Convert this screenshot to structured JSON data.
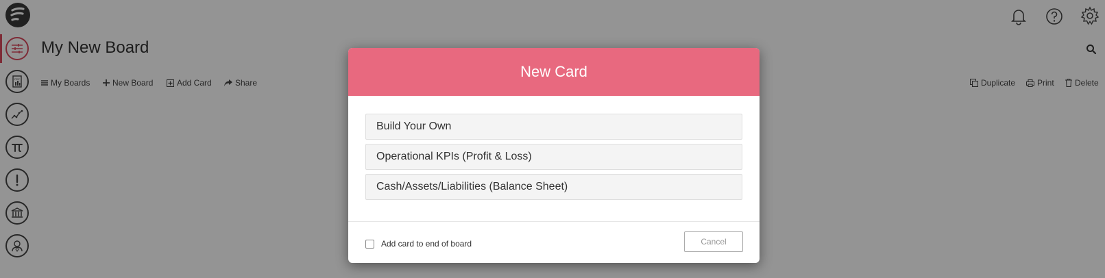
{
  "header": {
    "logo_icon": "brand-logo-icon",
    "icons": [
      "bell-icon",
      "help-icon",
      "gear-icon"
    ]
  },
  "sidebar": {
    "items": [
      {
        "icon": "sliders-icon",
        "active": true
      },
      {
        "icon": "pdf-report-icon"
      },
      {
        "icon": "trend-chart-icon"
      },
      {
        "icon": "pi-icon"
      },
      {
        "icon": "alert-icon"
      },
      {
        "icon": "bank-icon"
      },
      {
        "icon": "user-icon"
      }
    ],
    "accent_color": "#d94a5e"
  },
  "board": {
    "title": "My New Board"
  },
  "toolbar": {
    "my_boards": "My Boards",
    "new_board": "New Board",
    "add_card": "Add Card",
    "share": "Share",
    "duplicate": "Duplicate",
    "print": "Print",
    "delete": "Delete"
  },
  "modal": {
    "title": "New Card",
    "header_color": "#e8697f",
    "options": [
      "Build Your Own",
      "Operational KPIs (Profit & Loss)",
      "Cash/Assets/Liabilities (Balance Sheet)"
    ],
    "checkbox_label": "Add card to end of board",
    "checkbox_checked": false,
    "cancel_label": "Cancel"
  }
}
